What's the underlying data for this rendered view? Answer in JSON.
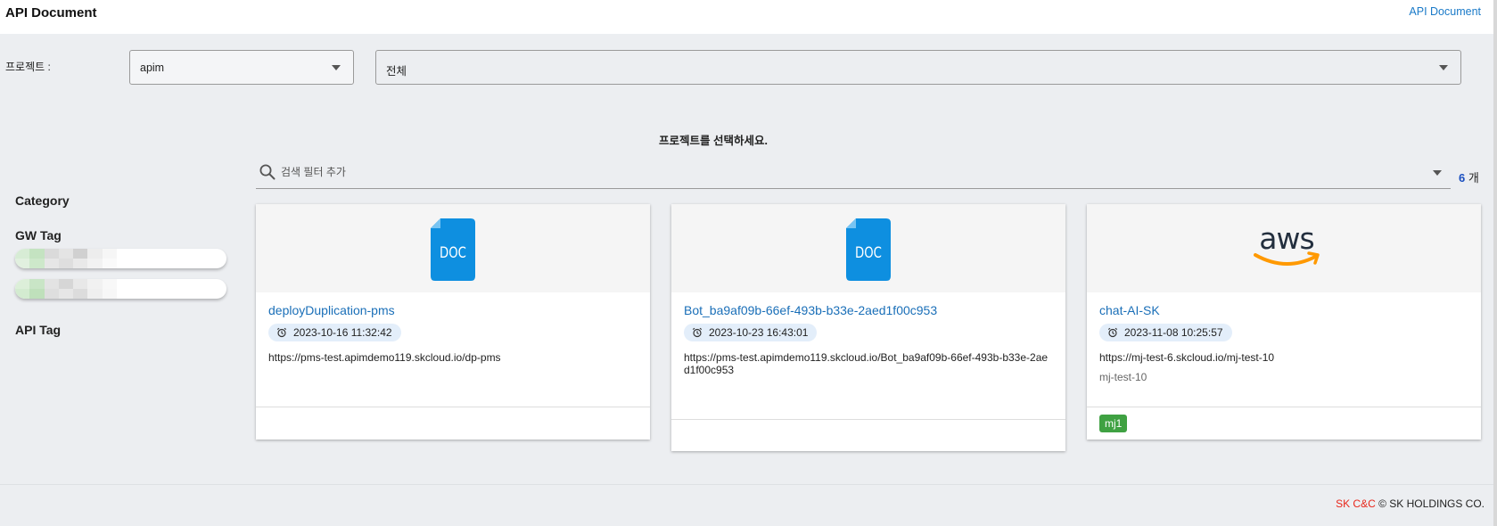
{
  "header": {
    "title": "API Document",
    "link_label": "API Document"
  },
  "filters": {
    "project_label": "프로젝트 :",
    "project_value": "apim",
    "scope_value": "전체"
  },
  "prompt": "프로젝트를 선택하세요.",
  "sidebar": {
    "category_label": "Category",
    "gw_tag_label": "GW Tag",
    "api_tag_label": "API Tag",
    "gw_tags": [
      "",
      ""
    ]
  },
  "search": {
    "placeholder": "검색 필터 추가",
    "count_value": "6",
    "count_unit": "개"
  },
  "cards": [
    {
      "icon": "doc-file-icon",
      "title": "deployDuplication-pms",
      "date": "2023-10-16 11:32:42",
      "url": "https://pms-test.apimdemo119.skcloud.io/dp-pms",
      "description": "",
      "tags": []
    },
    {
      "icon": "doc-file-icon",
      "title": "Bot_ba9af09b-66ef-493b-b33e-2aed1f00c953",
      "date": "2023-10-23 16:43:01",
      "url": "https://pms-test.apimdemo119.skcloud.io/Bot_ba9af09b-66ef-493b-b33e-2aed1f00c953",
      "description": "",
      "tags": []
    },
    {
      "icon": "aws-logo",
      "title": "chat-AI-SK",
      "date": "2023-11-08 10:25:57",
      "url": "https://mj-test-6.skcloud.io/mj-test-10",
      "description": "mj-test-10",
      "tags": [
        "mj1"
      ]
    }
  ],
  "footer": {
    "brand": "SK C&C",
    "copyright": "© SK HOLDINGS CO."
  },
  "colors": {
    "accent_blue": "#1a6fb8",
    "tag_green": "#3fa142",
    "brand_red": "#e8271b",
    "doc_icon_blue": "#0e8fe0"
  }
}
